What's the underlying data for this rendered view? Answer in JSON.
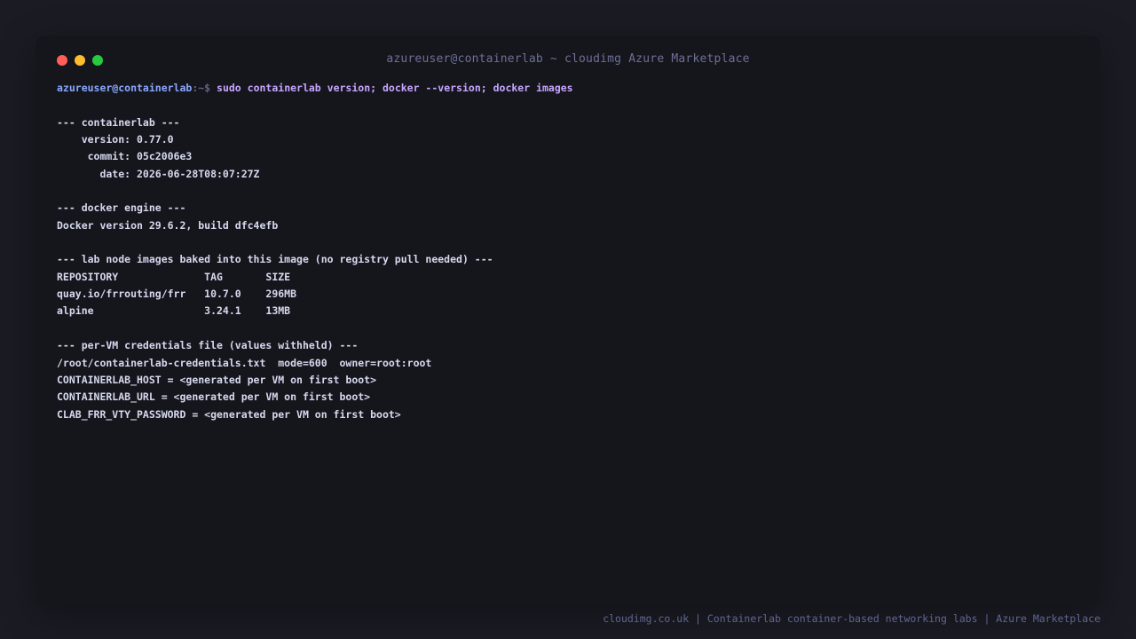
{
  "window": {
    "title": "azureuser@containerlab ~ cloudimg Azure Marketplace",
    "controls": [
      {
        "name": "close",
        "color": "#ff5f57"
      },
      {
        "name": "minimize",
        "color": "#febc2e"
      },
      {
        "name": "zoom",
        "color": "#28c840"
      }
    ]
  },
  "terminal": {
    "prompt": {
      "user_host": "azureuser@containerlab",
      "path": ":~$ ",
      "command": "sudo containerlab version; docker --version; docker images"
    },
    "lines": [
      "",
      "--- containerlab ---",
      "    version: 0.77.0",
      "     commit: 05c2006e3",
      "       date: 2026-06-28T08:07:27Z",
      "",
      "--- docker engine ---",
      "Docker version 29.6.2, build dfc4efb",
      "",
      "--- lab node images baked into this image (no registry pull needed) ---",
      "REPOSITORY              TAG       SIZE",
      "quay.io/frrouting/frr   10.7.0    296MB",
      "alpine                  3.24.1    13MB",
      "",
      "--- per-VM credentials file (values withheld) ---",
      "/root/containerlab-credentials.txt  mode=600  owner=root:root",
      "CONTAINERLAB_HOST = <generated per VM on first boot>",
      "CONTAINERLAB_URL = <generated per VM on first boot>",
      "CLAB_FRR_VTY_PASSWORD = <generated per VM on first boot>"
    ]
  },
  "footer": {
    "text": "cloudimg.co.uk | Containerlab container-based networking labs | Azure Marketplace"
  },
  "colors": {
    "background": "#1b1b24",
    "window": "#15151c",
    "prompt_user": "#8aa8ff",
    "prompt_command": "#c6a6ff",
    "output_text": "#d6d9ee",
    "muted_text": "#6c7196"
  }
}
